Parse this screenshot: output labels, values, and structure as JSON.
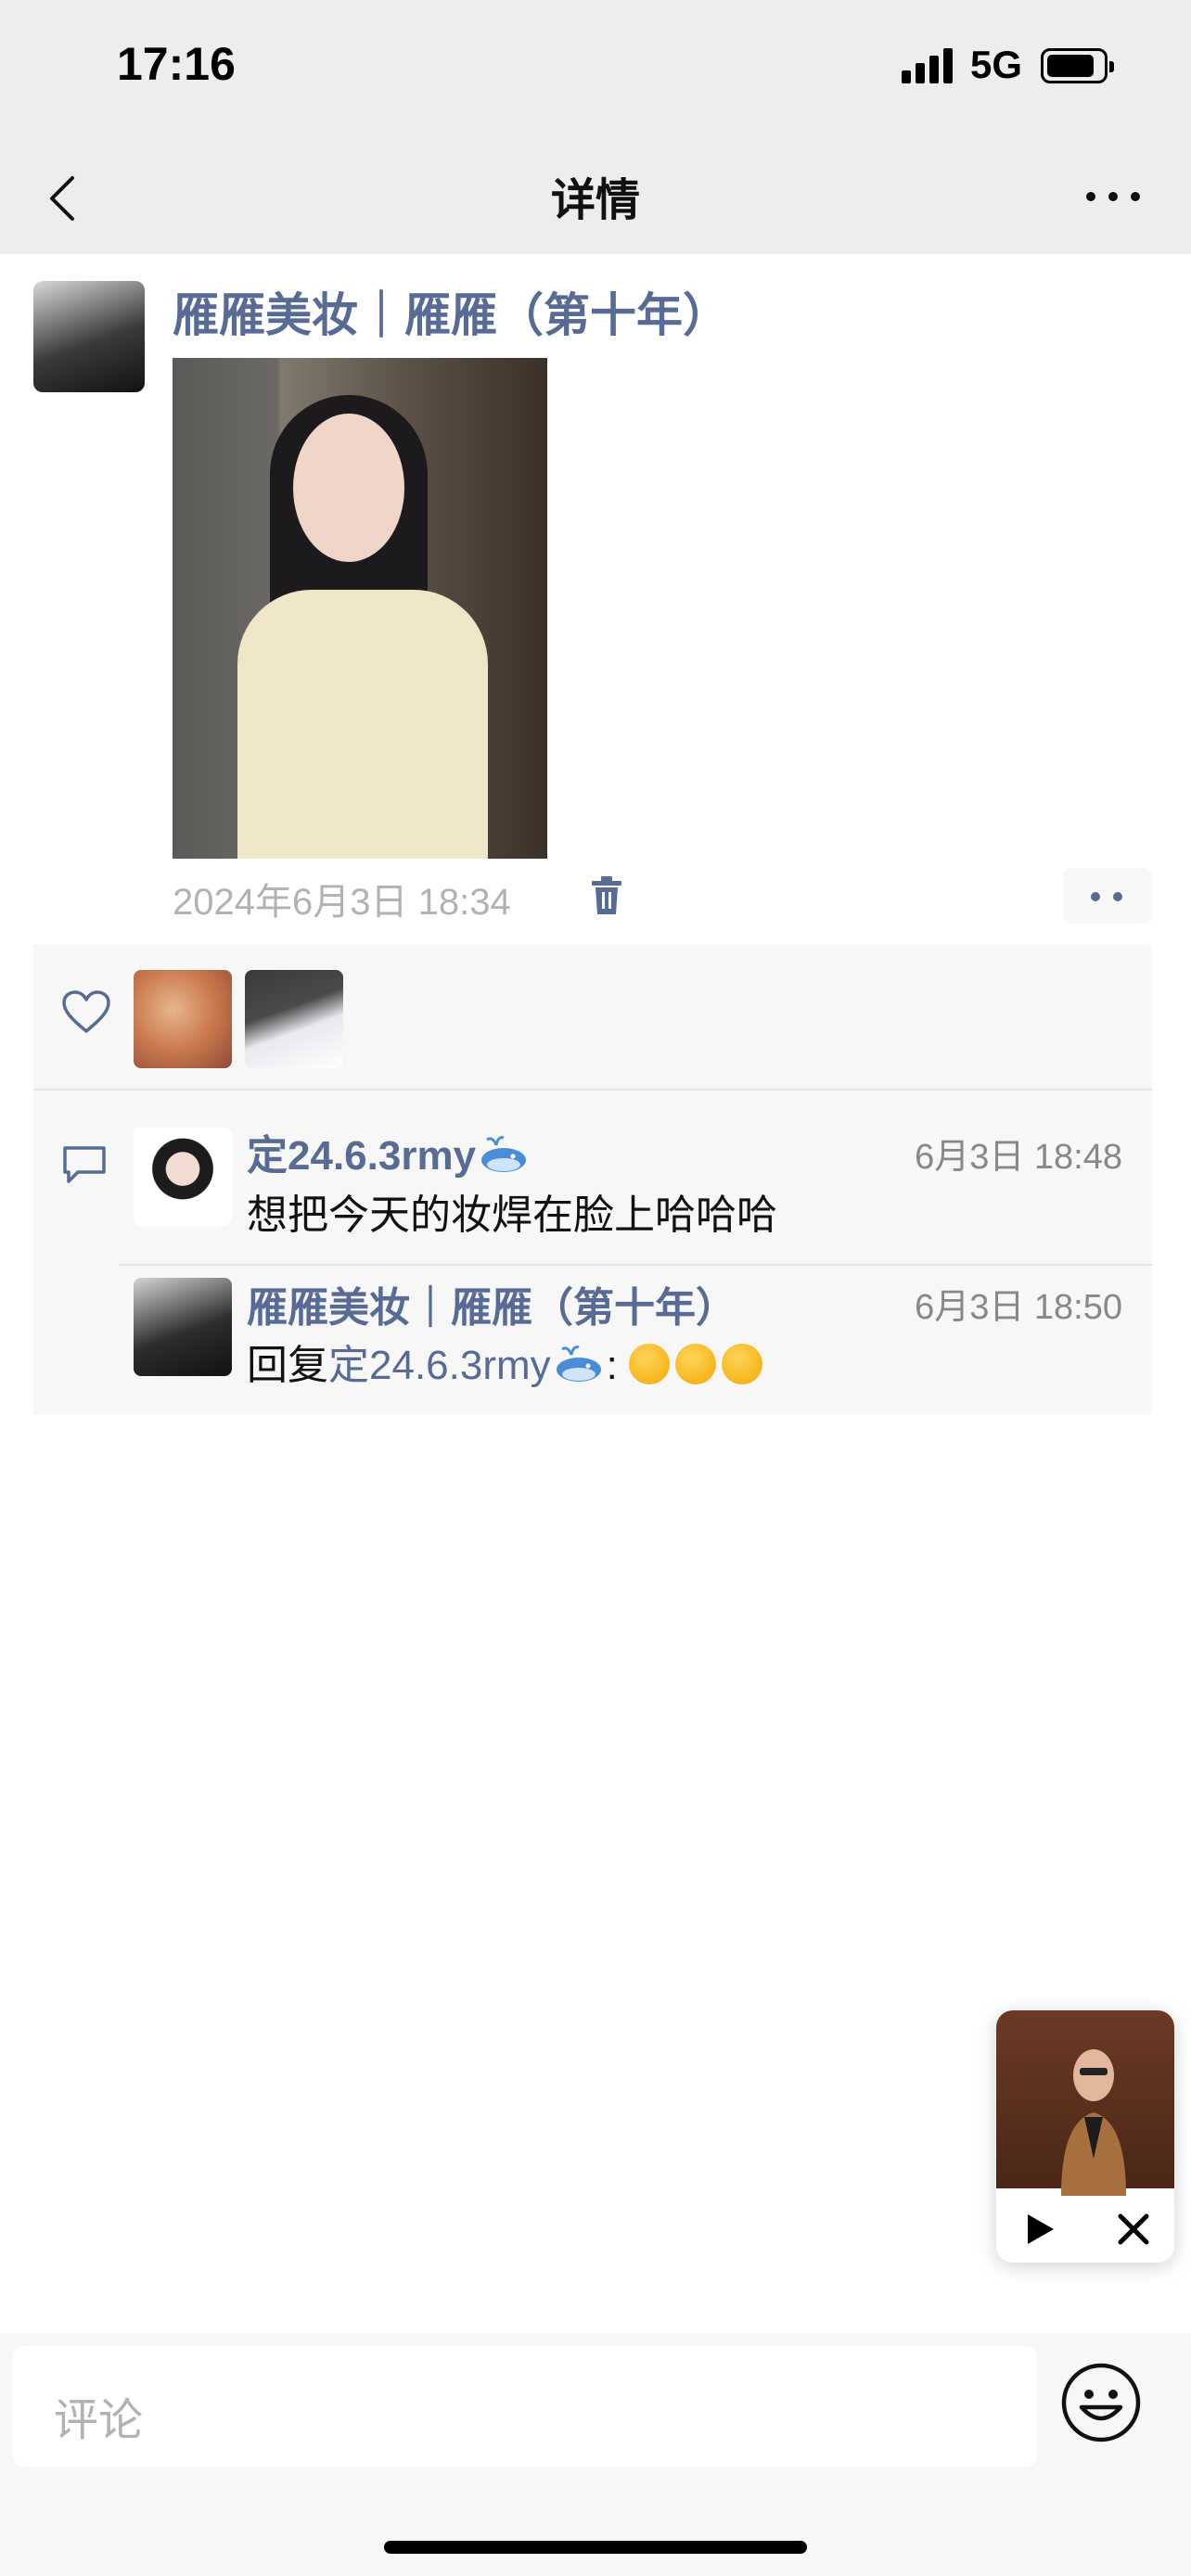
{
  "status": {
    "time": "17:16",
    "network": "5G"
  },
  "nav": {
    "title": "详情"
  },
  "post": {
    "author": "雁雁美妆｜雁雁（第十年）",
    "date": "2024年6月3日 18:34"
  },
  "comments": [
    {
      "name": "定24.6.3rmy",
      "time": "6月3日 18:48",
      "text": "想把今天的妆焊在脸上哈哈哈"
    },
    {
      "name": "雁雁美妆｜雁雁（第十年）",
      "time": "6月3日 18:50",
      "reply_prefix": "回复",
      "reply_to": "定24.6.3rmy",
      "reply_sep": ":"
    }
  ],
  "input": {
    "placeholder": "评论"
  },
  "icons": {
    "back": "chevron-left-icon",
    "more": "more-dots-icon",
    "trash": "trash-icon",
    "like": "heart-icon",
    "comment": "comment-bubble-icon",
    "emoji": "emoji-icon",
    "play": "play-icon",
    "close": "close-icon"
  },
  "colors": {
    "link": "#576b95",
    "bar": "#ededed",
    "panel": "#f7f7f7"
  }
}
